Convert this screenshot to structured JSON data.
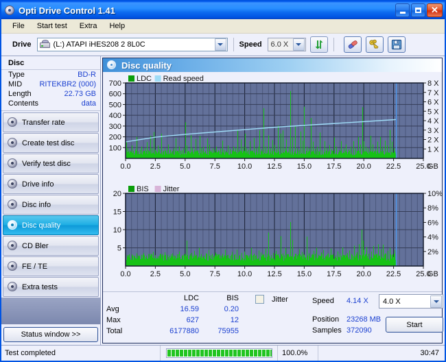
{
  "window": {
    "title": "Opti Drive Control 1.41",
    "icon": "disc-icon",
    "buttons": {
      "minimize": "_",
      "maximize": "□",
      "close": "✕"
    }
  },
  "menu": {
    "items": [
      "File",
      "Start test",
      "Extra",
      "Help"
    ]
  },
  "toolbar": {
    "drive_label": "Drive",
    "drive_value": "(L:)  ATAPI iHES208  2 8L0C",
    "speed_label": "Speed",
    "speed_value": "6.0 X",
    "refresh_icon": "refresh-arrows-icon",
    "erase_icon": "eraser-icon",
    "tools_icon": "keys-icon",
    "save_icon": "floppy-save-icon"
  },
  "disc": {
    "header": "Disc",
    "rows": [
      {
        "key": "Type",
        "value": "BD-R"
      },
      {
        "key": "MID",
        "value": "RITEKBR2 (000)"
      },
      {
        "key": "Length",
        "value": "22.73 GB"
      },
      {
        "key": "Contents",
        "value": "data"
      }
    ]
  },
  "sidebar": {
    "items": [
      {
        "label": "Transfer rate",
        "active": false
      },
      {
        "label": "Create test disc",
        "active": false
      },
      {
        "label": "Verify test disc",
        "active": false
      },
      {
        "label": "Drive info",
        "active": false
      },
      {
        "label": "Disc info",
        "active": false
      },
      {
        "label": "Disc quality",
        "active": true
      },
      {
        "label": "CD Bler",
        "active": false
      },
      {
        "label": "FE / TE",
        "active": false
      },
      {
        "label": "Extra tests",
        "active": false
      }
    ],
    "status_button": "Status window >>"
  },
  "panel": {
    "title": "Disc quality",
    "icon": "disc-icon"
  },
  "stats": {
    "col_ldc": "LDC",
    "col_bis": "BIS",
    "row_avg": "Avg",
    "row_max": "Max",
    "row_total": "Total",
    "avg_ldc": "16.59",
    "avg_bis": "0.20",
    "max_ldc": "627",
    "max_bis": "12",
    "total_ldc": "6177880",
    "total_bis": "75955",
    "jitter_label": "Jitter",
    "jitter_checked": false,
    "speed_label": "Speed",
    "speed_value": "4.14 X",
    "position_label": "Position",
    "position_value": "23268 MB",
    "samples_label": "Samples",
    "samples_value": "372090",
    "speed_select": "4.0 X",
    "start_button": "Start"
  },
  "statusbar": {
    "message": "Test completed",
    "percent": "100.0%",
    "elapsed": "30:47",
    "progress_blocks": 28
  },
  "colors": {
    "accent_blue": "#1a3fd0",
    "plot_bg": "#63719a",
    "ldc_green": "#16c216",
    "read_speed": "#9fdcf7",
    "jitter_pink": "#d8b4d8",
    "titlebar": "#0054e3"
  },
  "chart_data": [
    {
      "type": "area",
      "title": "Disc quality - LDC / Read speed",
      "xlabel": "GB",
      "ylabel": "LDC",
      "xlim": [
        0,
        25
      ],
      "ylim": [
        0,
        700
      ],
      "y2lim": [
        0,
        8
      ],
      "y2label": "X",
      "xticks": [
        "0.0",
        "2.5",
        "5.0",
        "7.5",
        "10.0",
        "12.5",
        "15.0",
        "17.5",
        "20.0",
        "22.5",
        "25.0"
      ],
      "yticks": [
        100,
        200,
        300,
        400,
        500,
        600,
        700
      ],
      "y2ticks": [
        "1 X",
        "2 X",
        "3 X",
        "4 X",
        "5 X",
        "6 X",
        "7 X",
        "8 X"
      ],
      "grid": true,
      "legend": [
        {
          "name": "LDC",
          "color": "#0a9e0a"
        },
        {
          "name": "Read speed",
          "color": "#9fdcf7"
        }
      ],
      "series": [
        {
          "name": "LDC",
          "color": "#16c216",
          "kind": "spikes",
          "baseline": 55,
          "x": [
            0.05,
            0.2,
            0.35,
            0.5,
            0.62,
            0.78,
            0.9,
            1.05,
            1.2,
            1.35,
            1.5,
            1.62,
            1.78,
            1.9,
            2.05,
            2.2,
            2.35,
            2.5,
            2.55,
            2.7,
            2.85,
            3.0,
            3.15,
            3.3,
            3.45,
            3.6,
            3.72,
            3.9,
            4.05,
            4.2,
            4.35,
            4.5,
            4.7,
            4.85,
            5.0,
            5.12,
            5.3,
            5.45,
            5.6,
            5.78,
            5.9,
            6.05,
            6.2,
            6.35,
            6.5,
            6.68,
            6.85,
            7.0,
            7.15,
            7.3,
            7.45,
            7.6,
            7.8,
            7.95,
            8.1,
            8.25,
            8.4,
            8.6,
            8.75,
            8.9,
            9.05,
            9.2,
            9.4,
            9.55,
            9.7,
            9.85,
            10.0,
            10.15,
            10.3,
            10.45,
            10.6,
            10.8,
            10.95,
            11.1,
            11.25,
            11.4,
            11.6,
            11.75,
            11.9,
            12.0,
            12.15,
            12.3,
            12.5,
            12.65,
            12.8,
            13.0,
            13.2,
            13.35,
            13.5,
            13.7,
            13.85,
            14.0,
            14.2,
            14.4,
            14.6,
            14.7,
            14.85,
            15.0,
            15.2,
            15.4,
            15.55,
            15.7,
            15.9,
            16.1,
            16.3,
            16.5,
            16.7,
            16.9,
            17.1,
            17.3,
            17.5,
            17.7,
            17.9,
            18.1,
            18.3,
            18.5,
            18.7,
            18.9,
            19.1,
            19.3,
            19.5,
            19.7,
            19.9,
            20.0,
            20.15,
            20.35,
            20.55,
            20.75,
            20.95,
            21.15,
            21.35,
            21.55,
            21.75,
            21.95,
            22.15,
            22.35,
            22.55,
            22.7
          ],
          "y": [
            160,
            95,
            75,
            120,
            70,
            85,
            200,
            65,
            80,
            110,
            70,
            95,
            150,
            75,
            210,
            95,
            245,
            80,
            70,
            120,
            85,
            230,
            70,
            95,
            75,
            130,
            80,
            70,
            95,
            185,
            70,
            110,
            75,
            95,
            335,
            120,
            70,
            215,
            95,
            80,
            180,
            75,
            210,
            95,
            110,
            70,
            185,
            130,
            75,
            95,
            80,
            110,
            75,
            95,
            165,
            80,
            70,
            120,
            90,
            75,
            110,
            95,
            265,
            80,
            175,
            110,
            230,
            95,
            80,
            160,
            75,
            190,
            95,
            110,
            260,
            85,
            465,
            110,
            80,
            215,
            95,
            170,
            125,
            85,
            305,
            230,
            260,
            95,
            175,
            110,
            625,
            200,
            305,
            95,
            80,
            250,
            165,
            480,
            110,
            95,
            375,
            155,
            90,
            110,
            240,
            75,
            160,
            95,
            125,
            85,
            195,
            110,
            75,
            160,
            95,
            130,
            85,
            110,
            160,
            95,
            200,
            130,
            475,
            160,
            110,
            95,
            210,
            130,
            85,
            155,
            200,
            110,
            165,
            120,
            265,
            155,
            95,
            100
          ],
          "note": "green spike/noise floor series, dense sampling"
        },
        {
          "name": "Read speed",
          "color": "#9fdcf7",
          "kind": "line",
          "axis": "y2",
          "x": [
            0.0,
            2.5,
            5.0,
            7.5,
            10.0,
            12.5,
            15.0,
            17.5,
            20.0,
            22.5,
            22.7
          ],
          "y": [
            1.75,
            2.25,
            2.55,
            2.8,
            3.05,
            3.3,
            3.5,
            3.7,
            3.9,
            4.1,
            4.12
          ]
        }
      ]
    },
    {
      "type": "area",
      "title": "Disc quality - BIS / Jitter",
      "xlabel": "GB",
      "ylabel": "BIS",
      "xlim": [
        0,
        25
      ],
      "ylim": [
        0,
        20
      ],
      "y2lim": [
        0,
        10
      ],
      "y2label": "%",
      "xticks": [
        "0.0",
        "2.5",
        "5.0",
        "7.5",
        "10.0",
        "12.5",
        "15.0",
        "17.5",
        "20.0",
        "22.5",
        "25.0"
      ],
      "yticks": [
        5,
        10,
        15,
        20
      ],
      "y2ticks": [
        "2%",
        "4%",
        "6%",
        "8%",
        "10%"
      ],
      "grid": true,
      "legend": [
        {
          "name": "BIS",
          "color": "#0a9e0a"
        },
        {
          "name": "Jitter",
          "color": "#d8b4d8"
        }
      ],
      "series": [
        {
          "name": "BIS",
          "color": "#16c216",
          "kind": "spikes",
          "baseline": 2.6,
          "x": [
            0.1,
            0.3,
            0.5,
            0.7,
            0.9,
            1.1,
            1.3,
            1.5,
            1.7,
            1.9,
            2.1,
            2.3,
            2.5,
            2.7,
            2.9,
            3.1,
            3.3,
            3.5,
            3.7,
            3.9,
            4.1,
            4.3,
            4.5,
            4.7,
            4.9,
            5.1,
            5.15,
            5.35,
            5.55,
            5.75,
            5.95,
            6.15,
            6.35,
            6.55,
            6.75,
            6.95,
            7.15,
            7.35,
            7.55,
            7.75,
            7.95,
            8.15,
            8.35,
            8.55,
            8.75,
            8.95,
            9.15,
            9.35,
            9.55,
            9.75,
            9.95,
            10.15,
            10.35,
            10.55,
            10.75,
            10.95,
            11.15,
            11.35,
            11.55,
            11.75,
            11.95,
            12.0,
            12.2,
            12.4,
            12.6,
            12.8,
            13.0,
            13.2,
            13.4,
            13.6,
            13.8,
            13.85,
            14.0,
            14.2,
            14.4,
            14.6,
            14.65,
            14.8,
            15.0,
            15.2,
            15.4,
            15.6,
            15.65,
            15.8,
            16.0,
            16.2,
            16.4,
            16.6,
            16.8,
            17.0,
            17.2,
            17.4,
            17.6,
            17.8,
            18.0,
            18.2,
            18.4,
            18.6,
            18.8,
            19.0,
            19.2,
            19.4,
            19.6,
            19.8,
            19.95,
            20.0,
            20.2,
            20.4,
            20.6,
            20.8,
            21.0,
            21.2,
            21.4,
            21.6,
            21.8,
            22.0,
            22.2,
            22.4,
            22.6,
            22.7
          ],
          "y": [
            3.0,
            2.8,
            3.2,
            2.9,
            3.5,
            2.7,
            3.1,
            3.6,
            2.9,
            3.3,
            2.8,
            3.9,
            3.0,
            2.7,
            3.4,
            2.9,
            3.8,
            3.1,
            2.8,
            3.5,
            2.9,
            3.2,
            4.0,
            2.8,
            3.3,
            7.0,
            3.1,
            2.9,
            3.6,
            4.2,
            3.0,
            5.0,
            3.3,
            2.9,
            3.5,
            4.4,
            3.0,
            2.8,
            3.7,
            3.1,
            2.9,
            3.4,
            4.5,
            3.0,
            2.8,
            3.9,
            3.2,
            4.5,
            3.0,
            3.6,
            4.0,
            3.1,
            2.9,
            5.0,
            3.4,
            3.0,
            4.3,
            3.7,
            3.1,
            4.8,
            3.3,
            9.2,
            3.0,
            3.6,
            4.2,
            3.1,
            8.2,
            3.5,
            5.0,
            3.2,
            4.4,
            12.1,
            7.2,
            3.4,
            3.0,
            4.6,
            3.2,
            3.9,
            3.1,
            8.1,
            3.5,
            2.9,
            3.3,
            4.2,
            5.0,
            3.1,
            3.7,
            4.4,
            3.0,
            3.5,
            4.8,
            3.2,
            2.9,
            4.0,
            3.4,
            5.1,
            3.0,
            3.6,
            4.3,
            3.1,
            5.6,
            3.8,
            6.0,
            10.0,
            7.0,
            4.5,
            5.2,
            3.4,
            4.0,
            5.5,
            3.2,
            6.0,
            4.6,
            5.9,
            3.5,
            4.2,
            5.0,
            3.3,
            4.4,
            3.0
          ]
        },
        {
          "name": "Jitter",
          "color": "#d8b4d8",
          "kind": "line",
          "axis": "y2",
          "x": [],
          "y": [],
          "note": "Jitter series disabled (checkbox unchecked); no data drawn"
        }
      ]
    }
  ]
}
